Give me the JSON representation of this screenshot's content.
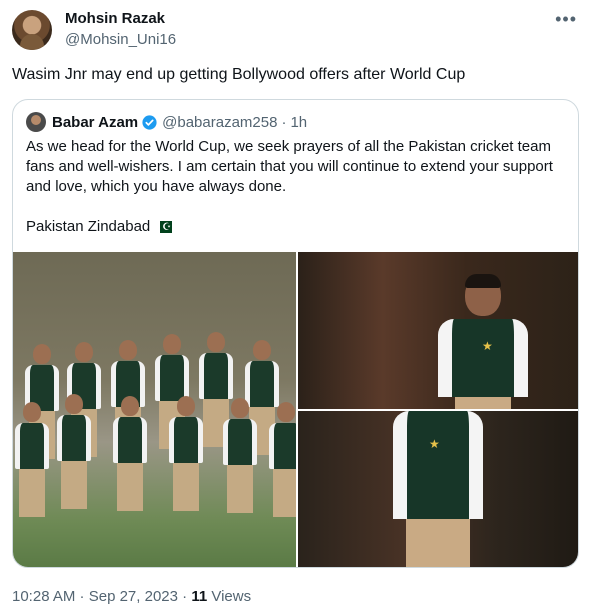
{
  "author": {
    "display_name": "Mohsin Razak",
    "handle": "@Mohsin_Uni16"
  },
  "more_icon": "more-horizontal-icon",
  "tweet": {
    "text": "Wasim Jnr may end up getting Bollywood offers after World Cup"
  },
  "quote": {
    "display_name": "Babar Azam",
    "handle": "@babarazam258",
    "separator": "·",
    "time": "1h",
    "verified_color": "#1d9bf0",
    "text": "As we head for the World Cup, we seek prayers of all the Pakistan cricket team fans and well-wishers. I am certain that you will continue to extend your support and love, which you have always done.",
    "signoff": "Pakistan Zindabad",
    "flag_icon": "pakistan-flag-icon"
  },
  "footer": {
    "time": "10:28 AM",
    "separator1": " · ",
    "date": "Sep 27, 2023",
    "separator2": " · ",
    "views_count": "11",
    "views_label": " Views"
  }
}
